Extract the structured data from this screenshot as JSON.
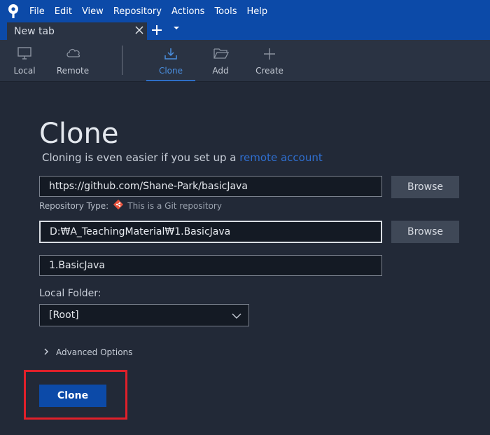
{
  "menu": {
    "items": [
      "File",
      "Edit",
      "View",
      "Repository",
      "Actions",
      "Tools",
      "Help"
    ]
  },
  "tabs": {
    "active_label": "New tab"
  },
  "toolbar": {
    "local": "Local",
    "remote": "Remote",
    "clone": "Clone",
    "add": "Add",
    "create": "Create",
    "active": "clone"
  },
  "main": {
    "title": "Clone",
    "subtitle_prefix": "Cloning is even easier if you set up a ",
    "subtitle_link": "remote account",
    "url_value": "https://github.com/Shane-Park/basicJava",
    "repo_type_label": "Repository Type:",
    "repo_type_value": "This is a Git repository",
    "path_value": "D:₩A_TeachingMaterial₩1.BasicJava",
    "name_value": "1.BasicJava",
    "browse_label": "Browse",
    "local_folder_label": "Local Folder:",
    "local_folder_value": "[Root]",
    "advanced_label": "Advanced Options",
    "clone_button": "Clone"
  },
  "colors": {
    "accent": "#0c4aa8",
    "link": "#2f6fd0",
    "background": "#222937",
    "highlight": "#e0202a"
  }
}
